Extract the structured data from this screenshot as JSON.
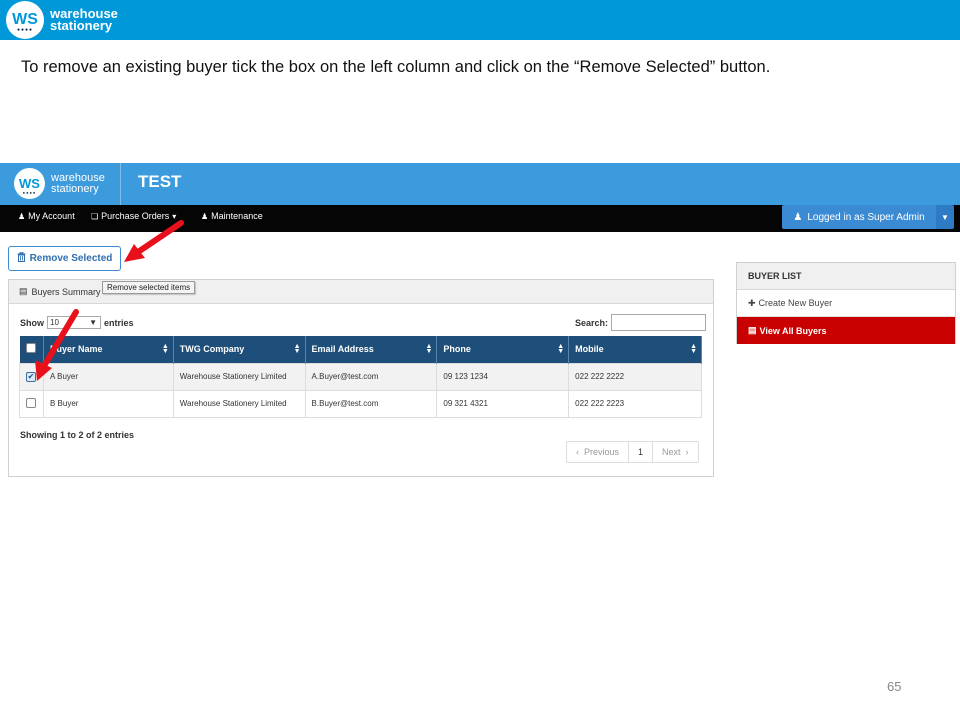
{
  "slide": {
    "logo": {
      "mark": "WS",
      "line1": "warehouse",
      "line2": "stationery"
    },
    "instruction": "To remove an existing buyer tick the box on the left column and click on the “Remove Selected” button.",
    "page_number": "65"
  },
  "app": {
    "logo": {
      "mark": "WS",
      "line1": "warehouse",
      "line2": "stationery"
    },
    "title": "TEST",
    "nav": [
      {
        "label": "My Account",
        "icon": "user-icon"
      },
      {
        "label": "Purchase Orders",
        "icon": "documents-icon"
      },
      {
        "label": "Maintenance",
        "icon": "user-icon"
      }
    ],
    "login_label": "Logged in as Super Admin",
    "remove_button": "Remove Selected",
    "tooltip": "Remove selected items",
    "panel_title": "Buyers Summary",
    "show_label": "Show",
    "show_value": "10",
    "entries_label": "entries",
    "search_label": "Search:",
    "columns": [
      "Buyer Name",
      "TWG Company",
      "Email Address",
      "Phone",
      "Mobile"
    ],
    "rows": [
      {
        "checked": true,
        "name": "A Buyer",
        "company": "Warehouse Stationery Limited",
        "email": "A.Buyer@test.com",
        "phone": "09 123 1234",
        "mobile": "022 222 2222"
      },
      {
        "checked": false,
        "name": "B Buyer",
        "company": "Warehouse Stationery Limited",
        "email": "B.Buyer@test.com",
        "phone": "09 321 4321",
        "mobile": "022 222 2223"
      }
    ],
    "showing": "Showing 1 to 2 of 2 entries",
    "pager": {
      "previous": "Previous",
      "page": "1",
      "next": "Next"
    },
    "buyer_list": {
      "title": "BUYER LIST",
      "items": [
        {
          "label": "Create New Buyer",
          "icon": "plus-icon"
        },
        {
          "label": "View All Buyers",
          "icon": "list-icon"
        }
      ]
    }
  },
  "colors": {
    "slide_header": "#0098d8",
    "app_bar": "#3b9bdc",
    "navbar": "#050505",
    "table_header": "#1e4f7a",
    "active_item": "#c80000",
    "arrow": "#e8101a"
  }
}
